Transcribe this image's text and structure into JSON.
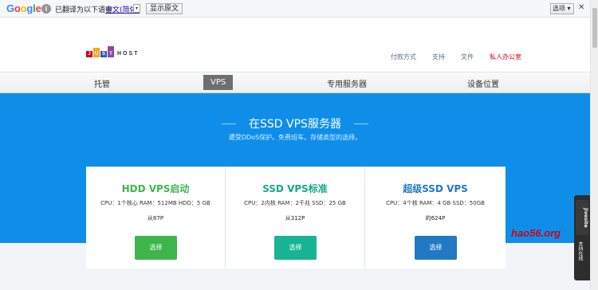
{
  "translate_bar": {
    "logo": [
      "G",
      "o",
      "o",
      "g",
      "l",
      "e"
    ],
    "logo_colors": [
      "#4285f4",
      "#ea4335",
      "#fbbc05",
      "#4285f4",
      "#34a853",
      "#ea4335"
    ],
    "info_glyph": "i",
    "message": "已翻译为以下语言：",
    "language": "中文(简体)",
    "dropdown_glyph": "▾",
    "show_original": "显示原文",
    "options": "选项 ▾",
    "close": "✕"
  },
  "header": {
    "logo_letters": [
      "J",
      "U",
      "S",
      "T"
    ],
    "logo_colors": [
      "#d0021b",
      "#f5a623",
      "#2b5fb8",
      "#8e44ad"
    ],
    "logo_text": "HOST",
    "links": [
      "付款方式",
      "支持",
      "文件"
    ],
    "office_link": "私人办公室"
  },
  "nav": {
    "items": [
      "托管",
      "VPS",
      "专用服务器",
      "设备位置"
    ],
    "active": "VPS"
  },
  "hero": {
    "title": "在SSD VPS服务器",
    "subtitle": "遭受DDoS保护。免费班车。存储类型的选择。"
  },
  "plans": [
    {
      "name": "HDD VPS启动",
      "spec": "CPU：1个核心 RAM：512MB HDD：5 GB",
      "price": "从87P",
      "button": "选择",
      "color": "#3db54a"
    },
    {
      "name": "SSD VPS标准",
      "spec": "CPU：2内核 RAM：2千兆 SSD：25 GB",
      "price": "从312P",
      "button": "选择",
      "color": "#17b392"
    },
    {
      "name": "超级SSD VPS",
      "spec": "CPU：4个核 RAM：4 GB SSD：50GB",
      "price": "的624P",
      "button": "选择",
      "color": "#2179c4"
    }
  ],
  "watermark": "hao56.org",
  "live_chat": {
    "brand": "jivosite",
    "label": "支持在线"
  }
}
